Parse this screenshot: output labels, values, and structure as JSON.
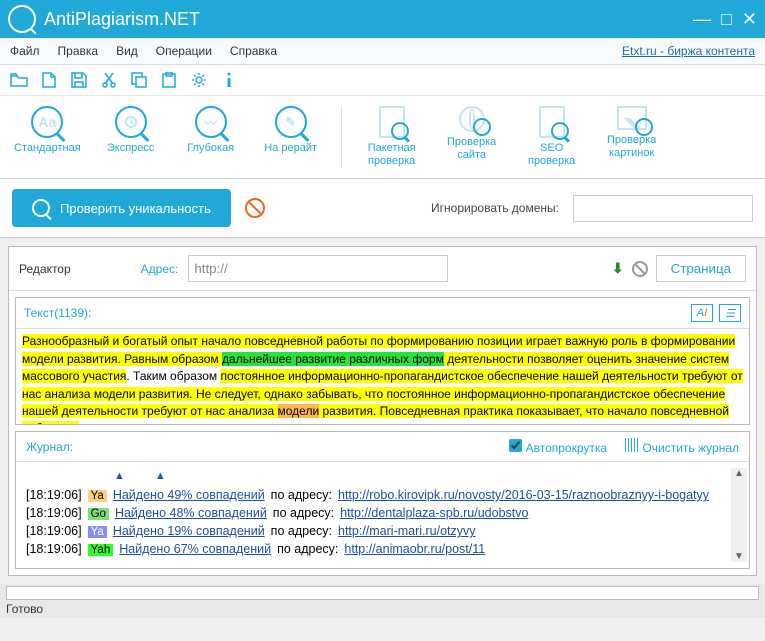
{
  "titlebar": {
    "title": "AntiPlagiarism.NET"
  },
  "menu": {
    "file": "Файл",
    "edit": "Правка",
    "view": "Вид",
    "ops": "Операции",
    "help": "Справка",
    "rlink": "Etxt.ru - биржа контента"
  },
  "tools": {
    "standard": "Стандартная",
    "express": "Экспресс",
    "deep": "Глубокая",
    "rewrite": "На рерайт",
    "batch": "Пакетная\nпроверка",
    "site": "Проверка\nсайта",
    "seo": "SEO\nпроверка",
    "images": "Проверка\nкартинок"
  },
  "action": {
    "check": "Проверить уникальность",
    "ignore_label": "Игнорировать домены:"
  },
  "addr": {
    "editor": "Редактор",
    "label": "Адрес:",
    "value": "http://",
    "page": "Страница"
  },
  "editor": {
    "count_label": "Текст(1139):"
  },
  "text": {
    "p1a": "Разнообразный и богатый опыт начало повседневной работы по формированию позиции играет важную роль в формировании модели развития. Равным образом ",
    "p1g": "дальнейшее развитие различных форм",
    "p1b": " деятельности позволяет оценить значение систем массового участия",
    "p1c": ". Таким образом ",
    "p1d": "постоянное информационно-пропагандистское обеспечение нашей деятельности требуют от нас анализа модели развития. Не следует, однако забывать, что постоянное информационно-пропагандистское обеспечение нашей деятельности требуют от нас анализа ",
    "p1o": "модели",
    "p1e": " развития. Повседневная практика показывает, что начало повседневной работы по"
  },
  "log": {
    "label": "Журнал:",
    "autoscroll": "Автопрокрутка",
    "clear": "Очистить журнал",
    "rows": [
      {
        "ts": "[18:19:06]",
        "badge": "Ya",
        "bclass": "b-ya",
        "found": "Найдено 49% совпадений",
        "addr": " по адресу: ",
        "url": "http://robo.kirovipk.ru/novosty/2016-03-15/raznoobraznyy-i-bogatyy"
      },
      {
        "ts": "[18:19:06]",
        "badge": "Go",
        "bclass": "b-go",
        "found": "Найдено 48% совпадений",
        "addr": " по адресу: ",
        "url": "http://dentalplaza-spb.ru/udobstvo"
      },
      {
        "ts": "[18:19:06]",
        "badge": "Ya",
        "bclass": "b-ya2",
        "found": "Найдено 19% совпадений",
        "addr": " по адресу: ",
        "url": "http://mari-mari.ru/otzyvy"
      },
      {
        "ts": "[18:19:06]",
        "badge": "Yah",
        "bclass": "b-yah",
        "found": "Найдено 67% совпадений",
        "addr": " по адресу: ",
        "url": "http://animaobr.ru/post/11"
      }
    ]
  },
  "status": {
    "ready": "Готово"
  }
}
